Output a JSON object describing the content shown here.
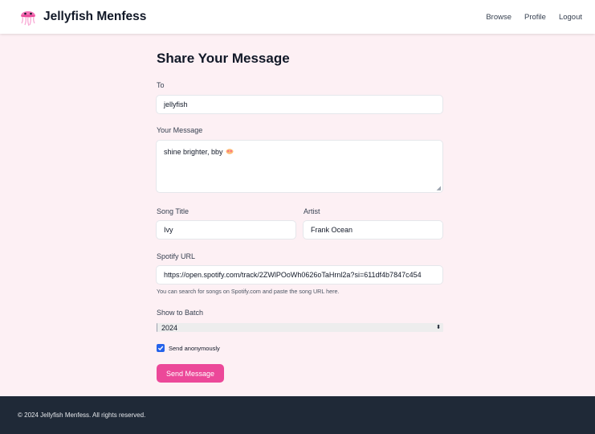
{
  "nav": {
    "brand": "Jellyfish Menfess",
    "links": [
      "Browse",
      "Profile",
      "Logout"
    ]
  },
  "form": {
    "title": "Share Your Message",
    "to": {
      "label": "To",
      "value": "jellyfish"
    },
    "message": {
      "label": "Your Message",
      "value": "shine brighter, bby"
    },
    "song_title": {
      "label": "Song Title",
      "value": "Ivy"
    },
    "artist": {
      "label": "Artist",
      "value": "Frank Ocean"
    },
    "spotify": {
      "label": "Spotify URL",
      "value": "https://open.spotify.com/track/2ZWlPOoWh0626oTaHrnl2a?si=611df4b7847c454",
      "helper": "You can search for songs on Spotify.com and paste the song URL here."
    },
    "batch": {
      "label": "Show to Batch",
      "selected": "2024"
    },
    "anonymous": {
      "label": "Send anonymously",
      "checked": true
    },
    "submit_label": "Send Message"
  },
  "footer": {
    "text": "© 2024 Jellyfish Menfess. All rights reserved."
  },
  "colors": {
    "accent": "#ec4899",
    "page_bg": "#fdf0f4",
    "footer_bg": "#1f2937",
    "checkbox": "#2563eb"
  },
  "icons": {
    "logo": "jellyfish-icon",
    "message_emoji": "face-emoji-icon",
    "select_arrow": "up-down-chevron-icon",
    "checkbox": "checkmark-icon"
  }
}
